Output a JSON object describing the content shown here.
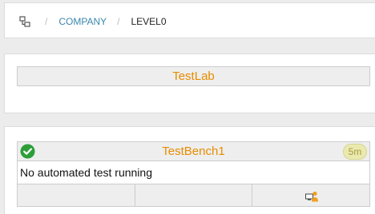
{
  "breadcrumb": {
    "items": [
      {
        "label": "COMPANY"
      },
      {
        "label": "LEVEL0"
      }
    ],
    "separator": "/"
  },
  "lab": {
    "name": "TestLab"
  },
  "bench": {
    "name": "TestBench1",
    "status_icon": "check-circle-icon",
    "age_badge": "5m",
    "status_text": "No automated test running",
    "action_icon": "monitor-user-icon"
  },
  "colors": {
    "accent_orange": "#e78c00",
    "link_blue": "#3a87ad",
    "success_green": "#2e9e3a"
  }
}
